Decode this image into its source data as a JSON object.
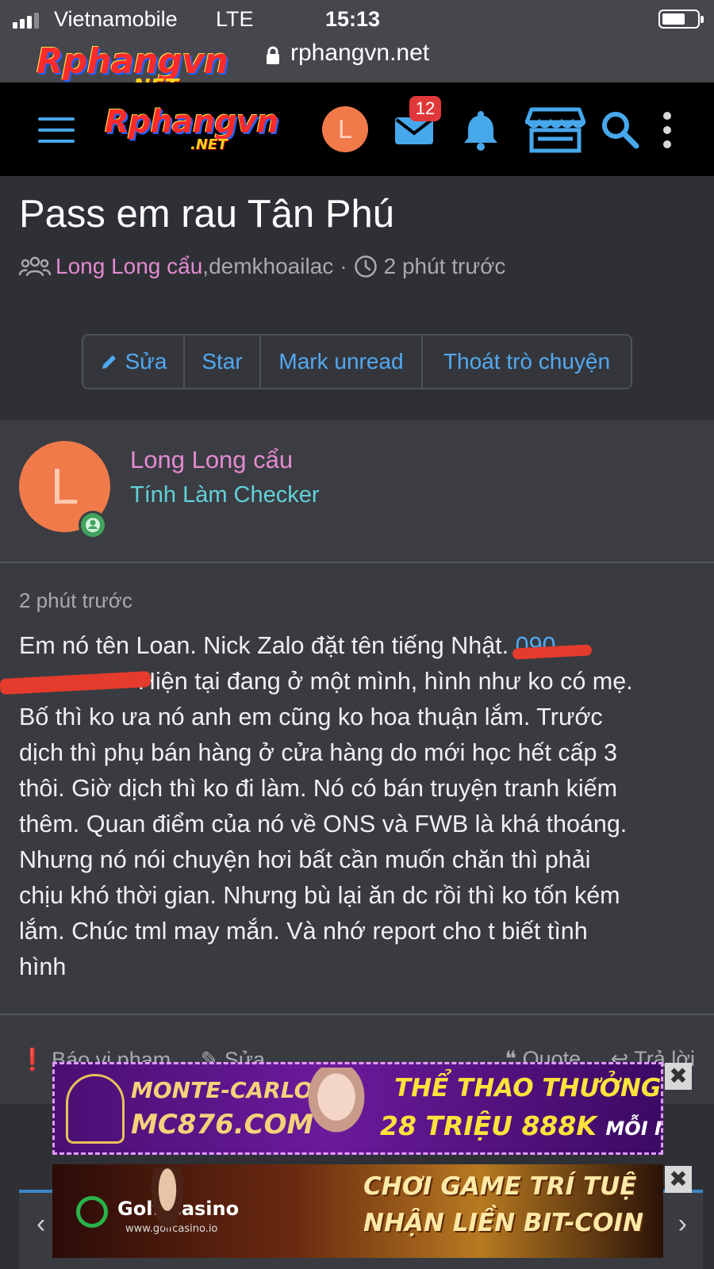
{
  "status_bar": {
    "carrier": "Vietnamobile",
    "network": "LTE",
    "time": "15:13"
  },
  "address_bar": {
    "url": "rphangvn.net"
  },
  "site": {
    "logo_text": "Rphangvn",
    "logo_suffix": ".NET",
    "header_avatar_letter": "L",
    "inbox_badge": "12",
    "colors": {
      "accent": "#47a7eb",
      "header_bg": "#000000",
      "page_bg": "#2e3036",
      "author": "#e48ad1",
      "user_title": "#61d2d8"
    },
    "icons": [
      "menu-icon",
      "mail-icon",
      "bell-icon",
      "store-icon",
      "search-icon",
      "more-vertical-icon"
    ]
  },
  "thread": {
    "title": "Pass em rau Tân Phú",
    "author": "Long Long cẩu",
    "participant_sep": ",",
    "participant": " demkhoailac",
    "dot": "·",
    "time_ago": "2 phút trước"
  },
  "actions": {
    "edit": "Sửa",
    "star": "Star",
    "mark_unread": "Mark unread",
    "leave": "Thoát trò chuyện"
  },
  "post": {
    "avatar_letter": "L",
    "username": "Long Long cẩu",
    "user_title": "Tính Làm Checker",
    "date": "2 phút trước",
    "lines": [
      "Em nó tên Loan. Nick Zalo đặt tên tiếng Nhật.",
      "Hiện tại đang ở một mình, hình như ko có mẹ.",
      "Bố thì ko ưa nó anh em cũng ko hoa thuận lắm. Trước",
      "dịch thì phụ bán hàng ở cửa hàng do mới học hết cấp 3",
      "thôi. Giờ dịch thì ko đi làm. Nó có bán truyện tranh kiếm",
      "thêm. Quan điểm của nó về ONS và FWB là khá thoáng.",
      "Nhưng nó nói chuyện hơi bất cần muốn chăn thì phải",
      "chịu khó thời gian. Nhưng bù lại ăn dc rồi thì ko tốn kém",
      "lắm. Chúc tml may mắn. Và nhớ report cho t biết tình",
      "hình"
    ],
    "redacted_prefix": "090",
    "footer": {
      "report": "Báo vi phạm",
      "edit": "Sửa",
      "quote": "Quote",
      "reply": "Trả lời"
    }
  },
  "ads": [
    {
      "brand": "MONTE-CARLO",
      "domain": "MC876.COM",
      "headline": "THỂ THAO THƯỞNG",
      "offer": "28 TRIỆU 888K",
      "offer_suffix": "MỖI NGÀY",
      "close": "✖"
    },
    {
      "brand": "Golf Casino",
      "domain": "www.golfcasino.io",
      "headline": "CHƠI GAME TRÍ TUỆ",
      "offer": "NHẬN LIỀN BIT-COIN",
      "close": "✖"
    }
  ]
}
